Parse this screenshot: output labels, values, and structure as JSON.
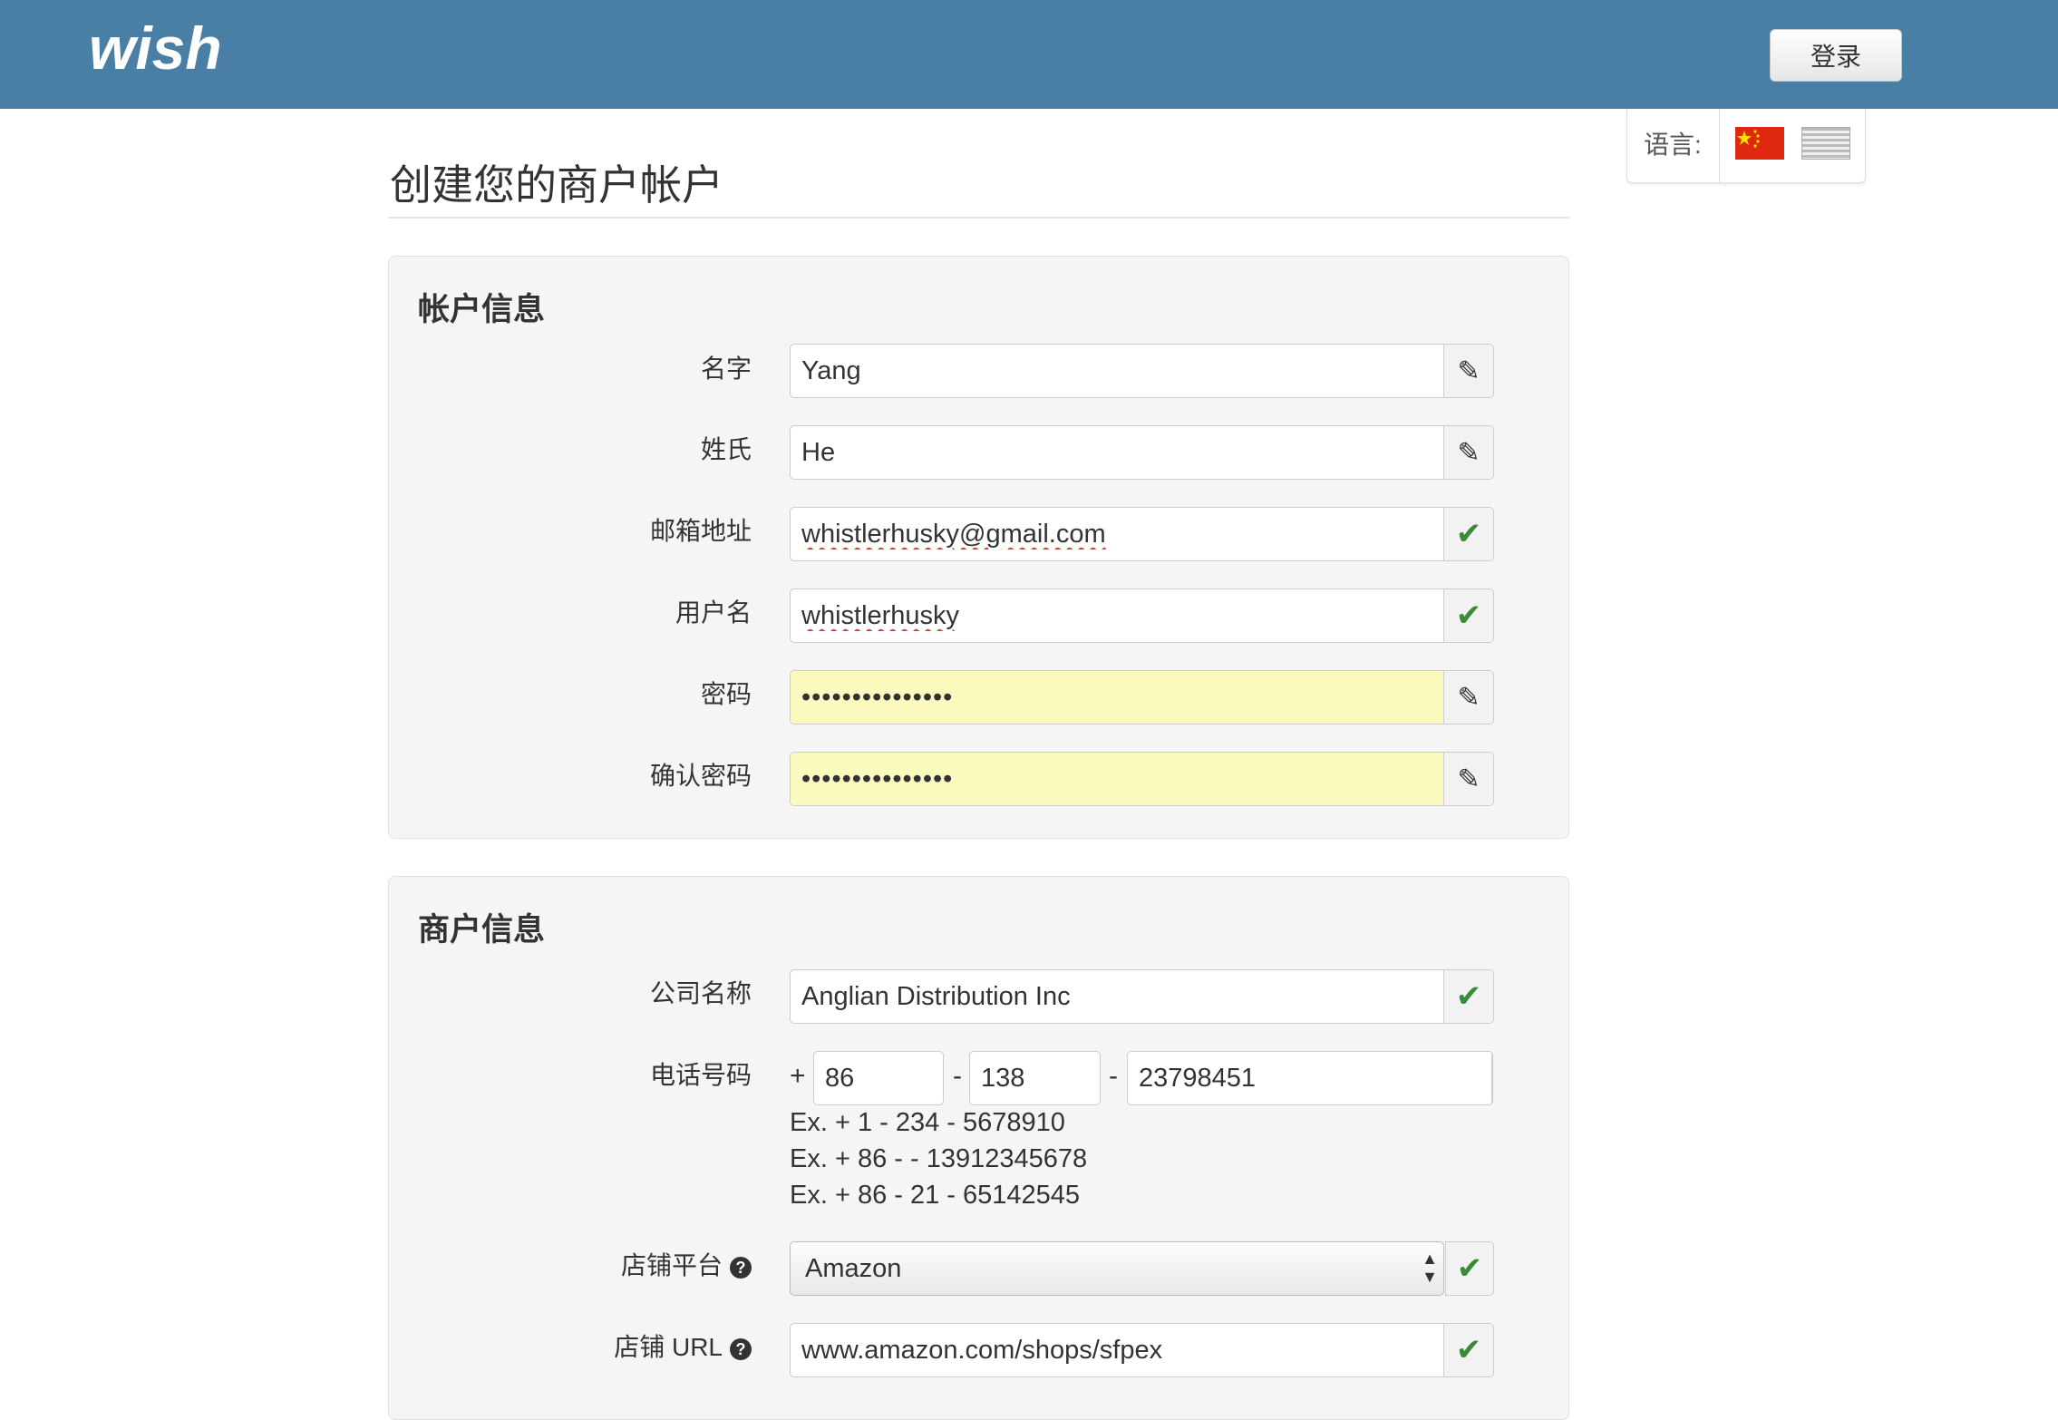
{
  "header": {
    "logo_text": "wish",
    "login_label": "登录"
  },
  "language": {
    "label": "语言:",
    "flags": [
      "china-flag-icon",
      "us-flag-icon"
    ]
  },
  "page": {
    "title": "创建您的商户帐户"
  },
  "account": {
    "title": "帐户信息",
    "first_name": {
      "label": "名字",
      "value": "Yang",
      "status": "pencil-icon"
    },
    "last_name": {
      "label": "姓氏",
      "value": "He",
      "status": "pencil-icon"
    },
    "email": {
      "label": "邮箱地址",
      "value": "whistlerhusky@gmail.com",
      "status": "check-icon"
    },
    "username": {
      "label": "用户名",
      "value": "whistlerhusky",
      "status": "check-icon"
    },
    "password": {
      "label": "密码",
      "value": "•••••••••••••••",
      "status": "pencil-icon"
    },
    "confirm_password": {
      "label": "确认密码",
      "value": "•••••••••••••••",
      "status": "pencil-icon"
    }
  },
  "merchant": {
    "title": "商户信息",
    "company": {
      "label": "公司名称",
      "value": "Anglian Distribution Inc",
      "status": "check-icon"
    },
    "phone": {
      "label": "电话号码",
      "plus": "+",
      "country_code": "86",
      "area_code": "138",
      "number": "23798451",
      "separator": "-",
      "examples": [
        "Ex. + 1 - 234 - 5678910",
        "Ex. + 86 - - 13912345678",
        "Ex. + 86 - 21 - 65142545"
      ]
    },
    "platform": {
      "label": "店铺平台",
      "value": "Amazon"
    },
    "store_url": {
      "label": "店铺 URL",
      "value": "www.amazon.com/shops/sfpex"
    }
  },
  "colors": {
    "header_bg": "#4a7fa5",
    "autofill_yellow": "#fafabf",
    "check_green": "#3a8a3a"
  }
}
